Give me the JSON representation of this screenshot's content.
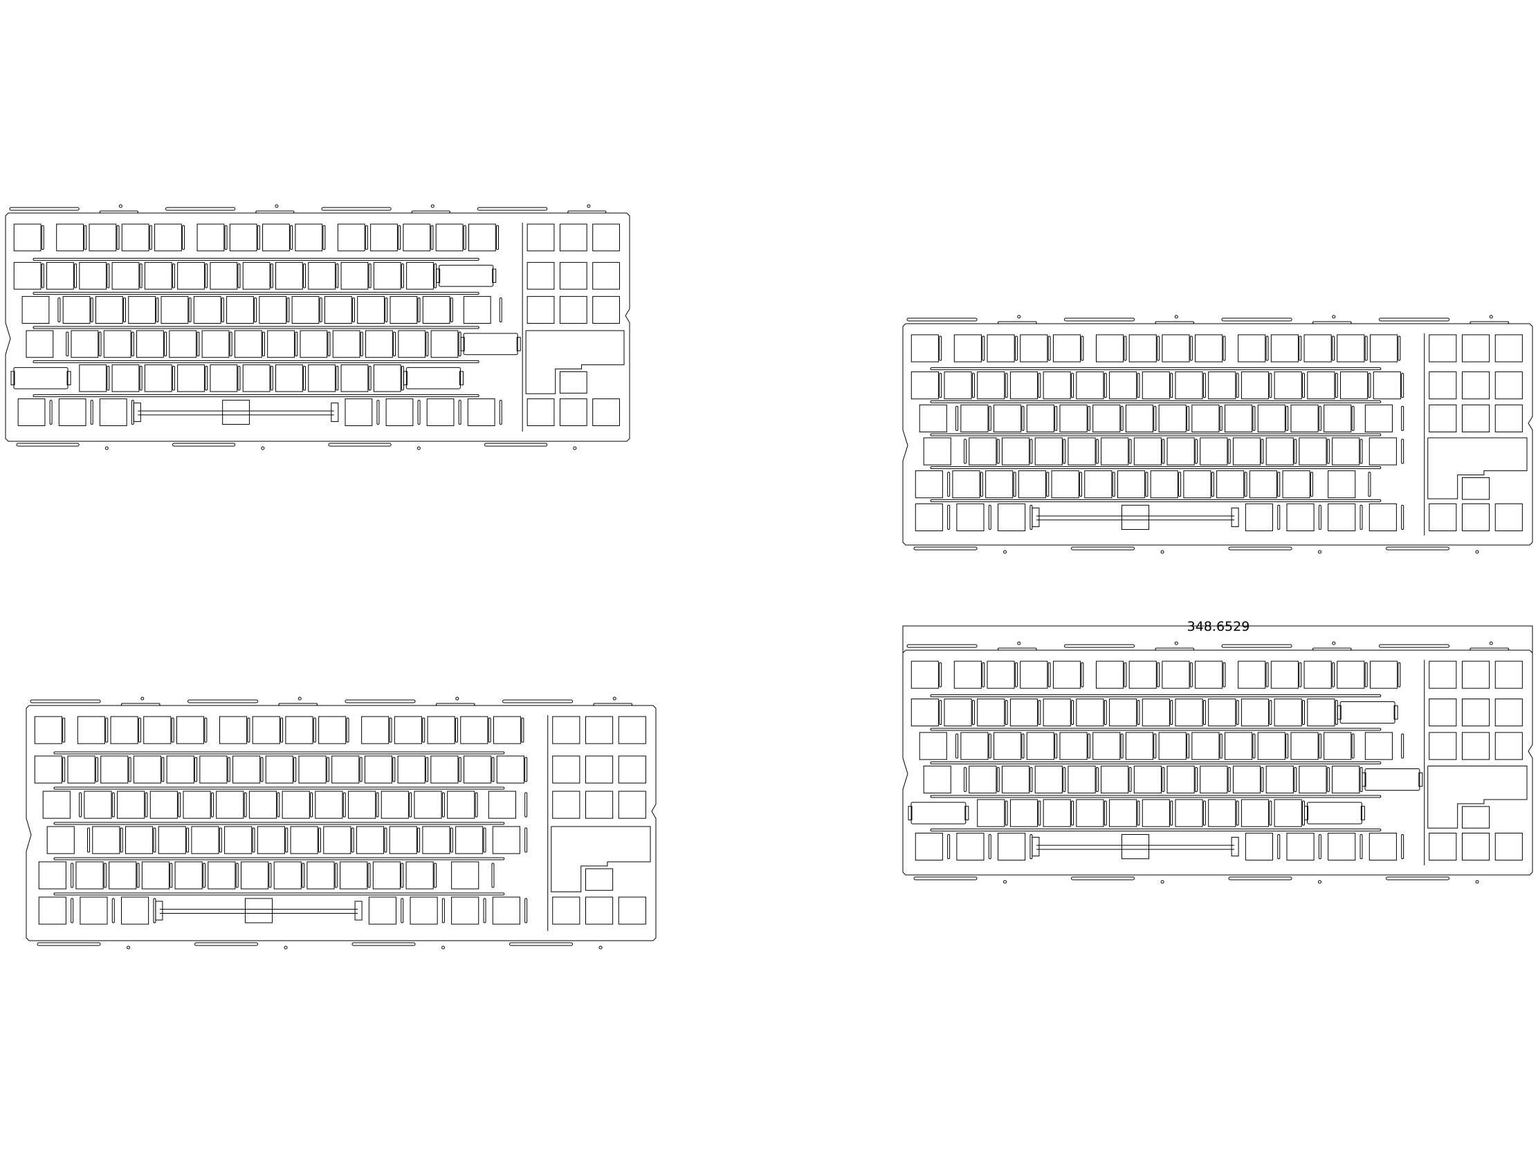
{
  "drawing": {
    "background": "#ffffff",
    "line_color": "#000000",
    "plates": [
      {
        "name": "plate-top-left",
        "layout": "iso",
        "stabilizer_style": "cutout"
      },
      {
        "name": "plate-top-right",
        "layout": "ansi",
        "stabilizer_style": "slot"
      },
      {
        "name": "plate-bottom-left",
        "layout": "ansi",
        "stabilizer_style": "slot"
      },
      {
        "name": "plate-bottom-right",
        "layout": "iso",
        "stabilizer_style": "cutout"
      }
    ],
    "dimension": {
      "label": "348.6529"
    }
  }
}
